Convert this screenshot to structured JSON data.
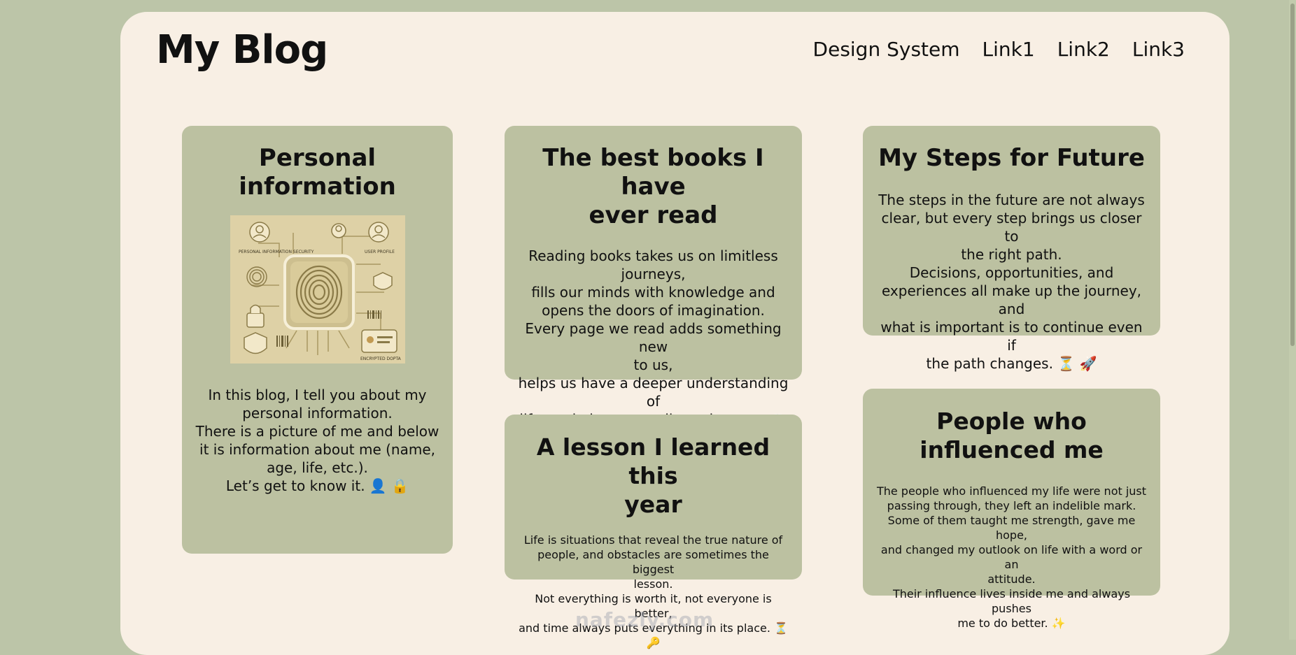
{
  "header": {
    "title": "My Blog",
    "nav": [
      {
        "label": "Design System"
      },
      {
        "label": "Link1"
      },
      {
        "label": "Link2"
      },
      {
        "label": "Link3"
      }
    ]
  },
  "cards": {
    "personal": {
      "title": "Personal\ninformation",
      "image_labels": {
        "security": "PERSONAL INFORMATION SECURITY",
        "profile": "USER PROFILE",
        "encrypted": "ENCRYPTED DOPTA"
      },
      "body": "In this blog, I tell you about my\npersonal information.\nThere is a picture of me and below\nit is information about me (name,\nage, life, etc.).\nLet’s get to know it. 👤 🔒"
    },
    "books": {
      "title": "The best books I have\never read",
      "body": "Reading books takes us on limitless\njourneys,\nfills our minds with knowledge and\nopens the doors of imagination.\nEvery page we read adds something new\nto us,\nhelps us have a deeper understanding of\nlife, and gives us endless pleasure. 📖 ✨"
    },
    "future": {
      "title": "My Steps for Future",
      "body": "The steps in the future are not always\nclear, but every step brings us closer to\nthe right path.\nDecisions, opportunities, and\nexperiences all make up the journey, and\nwhat is important is to continue even if\nthe path changes. ⏳ 🚀"
    },
    "lesson": {
      "title": "A lesson I learned this\nyear",
      "body": "Life is situations that reveal the true nature of\npeople, and obstacles are sometimes the biggest\nlesson.\nNot everything is worth it, not everyone is better,\nand time always puts everything in its place. ⏳ 🔑"
    },
    "people": {
      "title": "People who\ninfluenced me",
      "body": "The people who influenced my life were not just\npassing through, they left an indelible mark.\nSome of them taught me strength, gave me hope,\nand changed my outlook on life with a word or an\nattitude.\nTheir influence lives inside me and always pushes\nme to do better. ✨"
    }
  },
  "watermark": "nafezly.com",
  "colors": {
    "background": "#bcc5a8",
    "page": "#f8efe4",
    "card": "#bcc1a1"
  }
}
